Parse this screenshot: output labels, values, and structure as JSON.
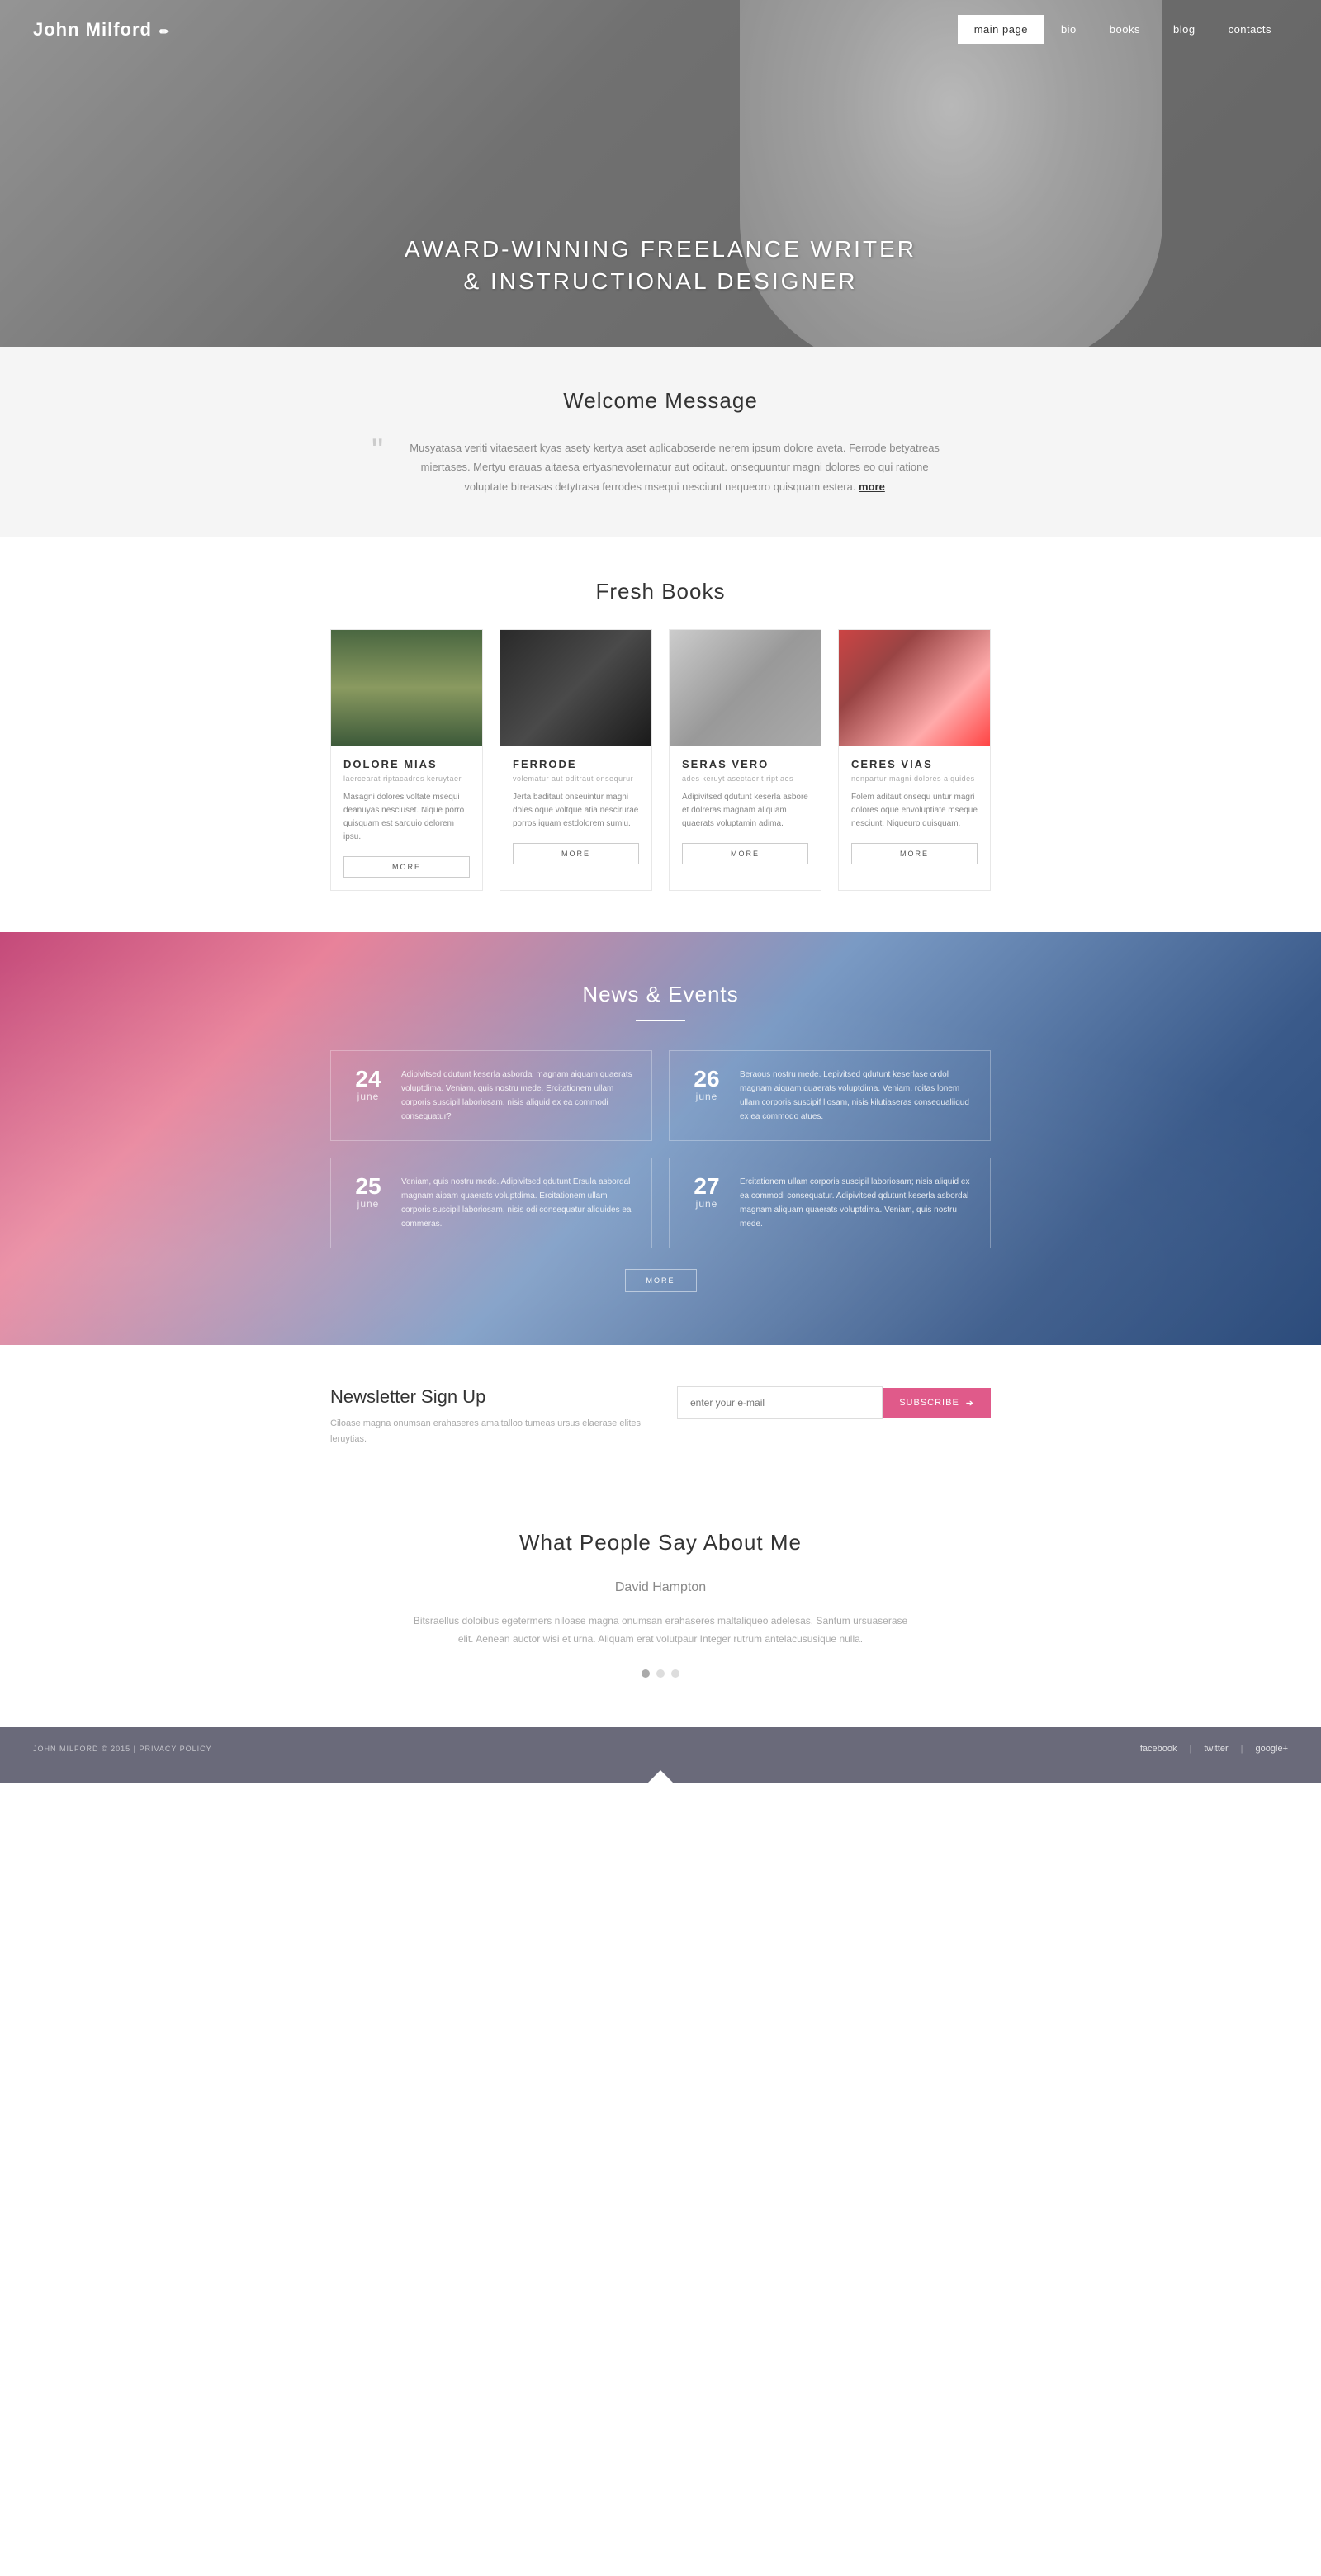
{
  "site": {
    "logo": "John Milford",
    "logo_icon": "✏"
  },
  "nav": {
    "links": [
      {
        "label": "main page",
        "active": true
      },
      {
        "label": "bio",
        "active": false
      },
      {
        "label": "books",
        "active": false
      },
      {
        "label": "blog",
        "active": false
      },
      {
        "label": "contacts",
        "active": false
      }
    ]
  },
  "hero": {
    "line1": "AWARD-WINNING FREELANCE WRITER",
    "line2": "& INSTRUCTIONAL DESIGNER"
  },
  "welcome": {
    "title": "Welcome Message",
    "text": "Musyatasa veriti vitaesaert kyas asety kertya aset aplicaboserde nerem ipsum dolore aveta. Ferrode betyatreas miertases. Mertyu erauas aitaesa ertyasnevolernatur aut oditaut. onsequuntur magni dolores eo qui ratione voluptate btreasas detytrasa ferrodes msequi nesciunt nequeoro quisquam estera.",
    "more_link": "more"
  },
  "fresh_books": {
    "title": "Fresh Books",
    "books": [
      {
        "img_class": "book-img-1",
        "title": "DOLORE MIAS",
        "subtitle": "laercearat riptacadres keruytaer",
        "desc": "Masagni dolores voltate msequi deanuyas nesciuset. Nique porro quisquam est sarquio delorem ipsu.",
        "more": "MORE"
      },
      {
        "img_class": "book-img-2",
        "title": "FERRODE",
        "subtitle": "volematur aut oditraut onsequrur",
        "desc": "Jerta baditaut onseuintur magni doles oque voltque atia.nescirurae porros iquam estdolorem sumiu.",
        "more": "MORE"
      },
      {
        "img_class": "book-img-3",
        "title": "SERAS VERO",
        "subtitle": "ades keruyt asectaerit riptiaes",
        "desc": "Adipivitsed qdutunt keserla asbore et dolreras magnam aliquam quaerats voluptamin adima.",
        "more": "MORE"
      },
      {
        "img_class": "book-img-4",
        "title": "CERES VIAS",
        "subtitle": "nonpartur magni dolores aiquides",
        "desc": "Folem aditaut onsequ untur magri dolores oque envoluptiate mseque nesciunt. Niqueuro quisquam.",
        "more": "MORE"
      }
    ]
  },
  "news_events": {
    "title": "News & Events",
    "items": [
      {
        "day": "24",
        "month": "june",
        "desc": "Adipivitsed qdutunt keserla asbordal magnam aiquam quaerats voluptdima. Veniam, quis nostru mede. Ercitationem ullam corporis suscipil laboriosam, nisis aliquid ex ea commodi consequatur?"
      },
      {
        "day": "26",
        "month": "june",
        "desc": "Beraous nostru mede. Lepivitsed qdutunt keserlase ordol magnam aiquam quaerats voluptdima. Veniam, roitas lonem ullam corporis suscipif liosam, nisis kilutiaseras consequaliiqud ex ea commodo atues."
      },
      {
        "day": "25",
        "month": "june",
        "desc": "Veniam, quis nostru mede. Adipivitsed qdutunt Ersula asbordal magnam aipam quaerats voluptdima. Ercitationem ullam corporis suscipil laboriosam, nisis odi consequatur aliquides ea commeras."
      },
      {
        "day": "27",
        "month": "june",
        "desc": "Ercitationem ullam corporis suscipil laboriosam; nisis aliquid ex ea commodi consequatur. Adipivitsed qdutunt keserla asbordal magnam aliquam quaerats voluptdima. Veniam, quis nostru mede."
      }
    ],
    "more_btn": "MORE"
  },
  "newsletter": {
    "title": "Newsletter Sign Up",
    "desc": "Ciloase magna onumsan erahaseres amaltalloo tumeas ursus elaerase elites leruytias.",
    "placeholder": "enter your e-mail",
    "subscribe": "SUBSCRIBE"
  },
  "testimonials": {
    "title": "What People Say About Me",
    "name": "David Hampton",
    "text": "Bitsraellus doloibus egetermers niloase magna onumsan erahaseres maltaliqueo adelesas. Santum ursuaserase elit. Aenean auctor wisi et urna. Aliquam erat volutpaur Integer rutrum antelacususique nulla.",
    "dots": [
      {
        "active": true
      },
      {
        "active": false
      },
      {
        "active": false
      }
    ]
  },
  "footer": {
    "copyright": "JOHN MILFORD © 2015  |  PRIVACY POLICY",
    "links": [
      "facebook",
      "twitter",
      "google+"
    ]
  }
}
